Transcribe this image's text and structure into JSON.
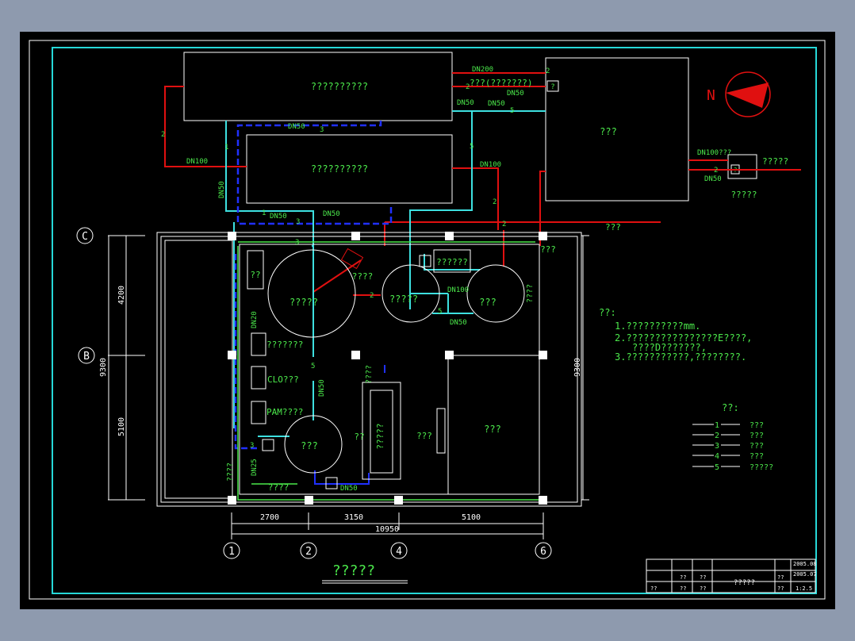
{
  "colors": {
    "background": "#000000",
    "frame": "#26d7d7",
    "red_pipe": "#e01010",
    "cyan_pipe": "#3de0e0",
    "blue_pipe": "#2030ff",
    "green_pipe": "#4be84b",
    "text": "#4be84b"
  },
  "tanks": {
    "top_tank_a": "??????????",
    "top_tank_b": "??????????",
    "big_room": "???",
    "small_box": "?????",
    "small_box_id": "?"
  },
  "top_labels": {
    "top_note": "???(???????)",
    "dn200": "DN200",
    "dn50_a": "DN50",
    "dn50_b": "DN50",
    "dn50_c": "DN50",
    "dn50_d": "DN50",
    "dn100_a": "DN100",
    "dn100_b": "DN100",
    "dn100_c": "DN100???",
    "dn50_e": "DN50",
    "dn50_f": "DN50",
    "dn50_g": "DN50",
    "pipe_label": "???",
    "n1": "1",
    "n2": "2",
    "n3": "3",
    "n5": "5"
  },
  "plan": {
    "tank1": "?????",
    "tank2": "?????",
    "tank3": "???",
    "tank4": "???",
    "small_a": "??",
    "label_a": "????",
    "label_b": "??????",
    "label_c": "???????",
    "clo": "CLO???",
    "pam": "PAM????",
    "pump": "?????",
    "room1": "???",
    "room2": "???",
    "bed": "??",
    "right_vert": "????",
    "bottom_lbl": "????",
    "left_lbl": "????",
    "dn50_v": "DN50",
    "dn20": "DN20",
    "dn25": "DN25",
    "dn50_h": "DN50",
    "dn50_b2": "DN50",
    "dn100_p": "DN100",
    "dn50_p": "DN50",
    "top_right": "???"
  },
  "axes": {
    "C": "C",
    "B": "B",
    "c1": "1",
    "c2": "2",
    "c4": "4",
    "c6": "6",
    "dim_4200": "4200",
    "dim_5100_v": "5100",
    "dim_9300_l": "9300",
    "dim_9300_r": "9300",
    "dim_2700": "2700",
    "dim_3150": "3150",
    "dim_5100": "5100",
    "dim_10950": "10950"
  },
  "notes": {
    "heading": "??:",
    "line1": "1.??????????mm.",
    "line2": "2.????????????????E????,",
    "line2b": "????D???????,",
    "line3": "3.???????????,????????."
  },
  "legend": {
    "heading": "??:",
    "items": [
      {
        "num": "1",
        "label": "???"
      },
      {
        "num": "2",
        "label": "???"
      },
      {
        "num": "3",
        "label": "???"
      },
      {
        "num": "4",
        "label": "???"
      },
      {
        "num": "5",
        "label": "?????"
      }
    ]
  },
  "title": "?????",
  "title_block": {
    "name": "?????",
    "date1": "2005.08",
    "date2": "2005.07",
    "cells": [
      "??",
      "??",
      "??",
      "??",
      "??",
      "??",
      "??",
      "1:2.5"
    ]
  }
}
